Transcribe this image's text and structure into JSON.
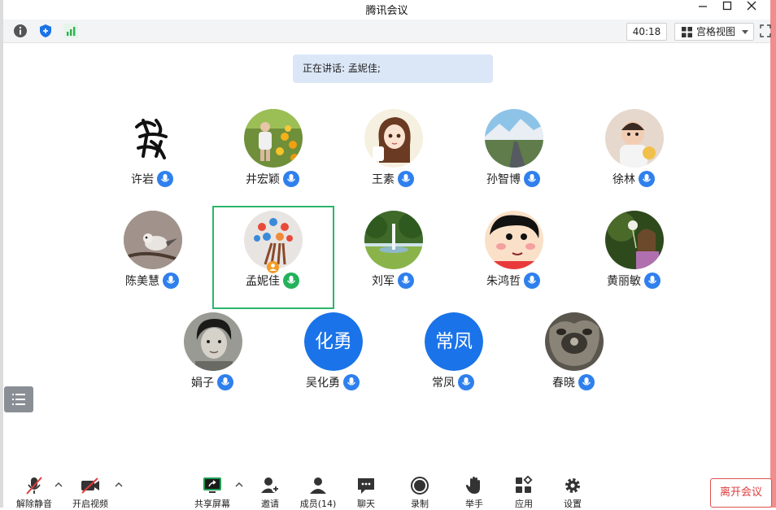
{
  "window": {
    "title": "腾讯会议"
  },
  "topbar": {
    "timer": "40:18",
    "view_label": "宫格视图"
  },
  "speaking": {
    "text": "正在讲话: 孟妮佳;"
  },
  "participants": [
    {
      "name": "许岩",
      "avatar": "calligraphy-avatar",
      "mic_color": "#2f80ed"
    },
    {
      "name": "井宏颖",
      "avatar": "child-flowers-avatar",
      "mic_color": "#2f80ed"
    },
    {
      "name": "王素",
      "avatar": "anime-girl-avatar",
      "mic_color": "#2f80ed"
    },
    {
      "name": "孙智博",
      "avatar": "mountain-road-avatar",
      "mic_color": "#2f80ed"
    },
    {
      "name": "徐林",
      "avatar": "baby-avatar",
      "mic_color": "#2f80ed"
    },
    {
      "name": "陈美慧",
      "avatar": "bird-branch-avatar",
      "mic_color": "#2f80ed"
    },
    {
      "name": "孟妮佳",
      "avatar": "balloons-avatar",
      "mic_color": "#24b25a"
    },
    {
      "name": "刘军",
      "avatar": "fountain-park-avatar",
      "mic_color": "#2f80ed"
    },
    {
      "name": "朱鸿哲",
      "avatar": "cartoon-boy-avatar",
      "mic_color": "#2f80ed"
    },
    {
      "name": "黄丽敏",
      "avatar": "girl-dandelion-avatar",
      "mic_color": "#2f80ed"
    },
    {
      "name": "娟子",
      "avatar": "old-photo-child-avatar",
      "mic_color": "#2f80ed"
    },
    {
      "name": "吴化勇",
      "initials": "化勇",
      "mic_color": "#2f80ed"
    },
    {
      "name": "常凤",
      "initials": "常凤",
      "mic_color": "#2f80ed"
    },
    {
      "name": "春晓",
      "avatar": "animal-fur-avatar",
      "mic_color": "#2f80ed"
    }
  ],
  "bottombar": {
    "unmute": "解除静音",
    "video": "开启视频",
    "share": "共享屏幕",
    "invite": "邀请",
    "members": "成员(14)",
    "chat": "聊天",
    "record": "录制",
    "raise_hand": "举手",
    "apps": "应用",
    "settings": "设置",
    "leave": "离开会议"
  },
  "colors": {
    "accent": "#1a73e8",
    "active_border": "#2bb56b",
    "leave": "#e03b3b"
  }
}
